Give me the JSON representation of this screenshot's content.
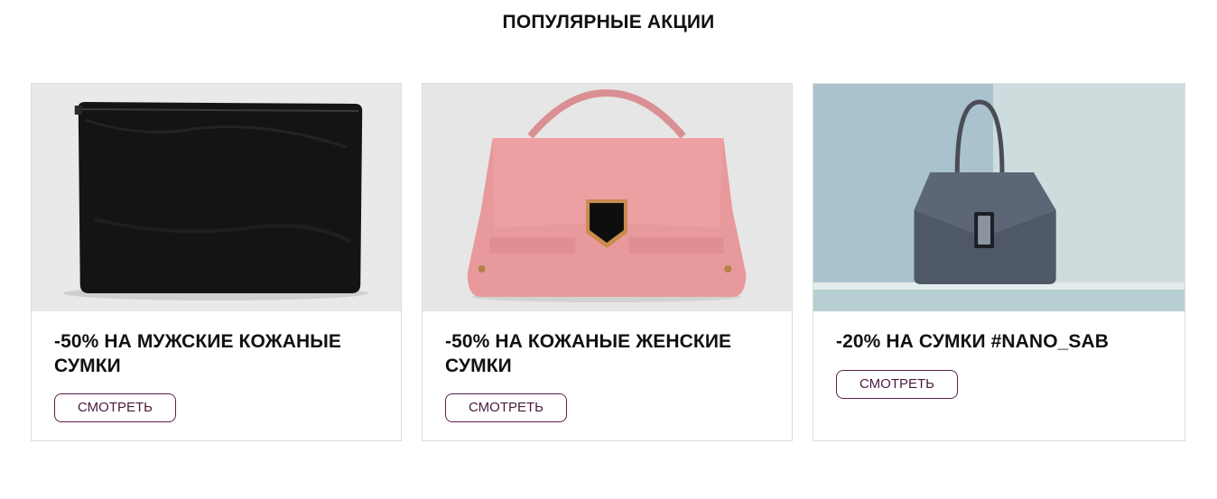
{
  "section": {
    "title": "ПОПУЛЯРНЫЕ АКЦИИ"
  },
  "promos": [
    {
      "title": "-50% НА МУЖСКИЕ КОЖАНЫЕ СУМКИ",
      "button_label": "СМОТРЕТЬ",
      "image_alt": "black leather clutch bag"
    },
    {
      "title": "-50% НА КОЖАНЫЕ ЖЕНСКИЕ СУМКИ",
      "button_label": "СМОТРЕТЬ",
      "image_alt": "pink leather handbag"
    },
    {
      "title": "-20% НА СУМКИ #NANO_SAB",
      "button_label": "СМОТРЕТЬ",
      "image_alt": "dark blue handbag on glass stand"
    }
  ],
  "colors": {
    "button_border": "#5b1f4a",
    "button_text": "#4b1a3e",
    "card_border": "#dcdcdc"
  }
}
